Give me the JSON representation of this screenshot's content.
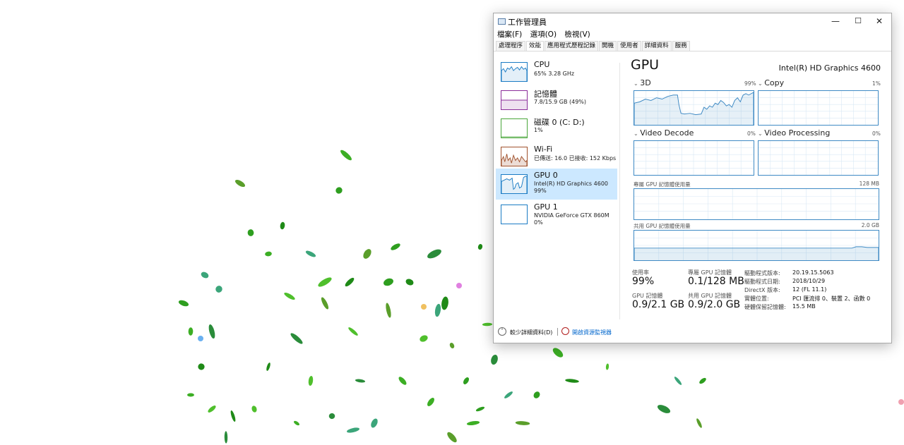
{
  "window": {
    "title": "工作管理員",
    "controls": {
      "minimize": "—",
      "maximize": "☐",
      "close": "✕"
    }
  },
  "menu": [
    "檔案(F)",
    "選項(O)",
    "檢視(V)"
  ],
  "tabs": [
    "處理程序",
    "效能",
    "應用程式歷程記錄",
    "開機",
    "使用者",
    "詳細資料",
    "服務"
  ],
  "active_tab": "效能",
  "sidebar": [
    {
      "name": "CPU",
      "sub": "65%  3.28 GHz",
      "color": "#1a7bc4"
    },
    {
      "name": "記憶體",
      "sub": "7.8/15.9 GB (49%)",
      "color": "#8b2d9a"
    },
    {
      "name": "磁碟 0 (C: D:)",
      "sub": "1%",
      "color": "#4aa63a"
    },
    {
      "name": "Wi-Fi",
      "sub": "已傳送: 16.0  已接收: 152 Kbps",
      "color": "#a0522d"
    },
    {
      "name": "GPU 0",
      "sub": "Intel(R) HD Graphics 4600",
      "sub2": "99%",
      "color": "#1a7bc4"
    },
    {
      "name": "GPU 1",
      "sub": "NVIDIA GeForce GTX 860M",
      "sub2": "0%",
      "color": "#1a7bc4"
    }
  ],
  "detail": {
    "title": "GPU",
    "model": "Intel(R) HD Graphics 4600",
    "engines": [
      {
        "name": "3D",
        "pct": "99%"
      },
      {
        "name": "Copy",
        "pct": "1%"
      },
      {
        "name": "Video Decode",
        "pct": "0%"
      },
      {
        "name": "Video Processing",
        "pct": "0%"
      }
    ],
    "dedicated": {
      "label": "專屬 GPU 記憶體使用量",
      "max": "128 MB"
    },
    "shared": {
      "label": "共用 GPU 記憶體使用量",
      "max": "2.0 GB"
    },
    "stats": [
      {
        "label": "使用率",
        "value": "99%"
      },
      {
        "label": "專屬 GPU 記憶體",
        "value": "0.1/128 MB"
      },
      {
        "label": "GPU 記憶體",
        "value": "0.9/2.1 GB"
      },
      {
        "label": "共用 GPU 記憶體",
        "value": "0.9/2.0 GB"
      }
    ],
    "info": [
      {
        "k": "驅動程式版本:",
        "v": "20.19.15.5063"
      },
      {
        "k": "驅動程式日期:",
        "v": "2018/10/29"
      },
      {
        "k": "DirectX 版本:",
        "v": "12 (FL 11.1)"
      },
      {
        "k": "實體位置:",
        "v": "PCI 匯流排 0、裝置 2、函數 0"
      },
      {
        "k": "硬體保留記憶體:",
        "v": "15.5 MB"
      }
    ]
  },
  "footer": {
    "fewer": "較少詳細資料(D)",
    "monitor": "開啟資源監視器"
  },
  "theme": {
    "accent": "#3f8ac4",
    "selection": "#cce8ff"
  }
}
